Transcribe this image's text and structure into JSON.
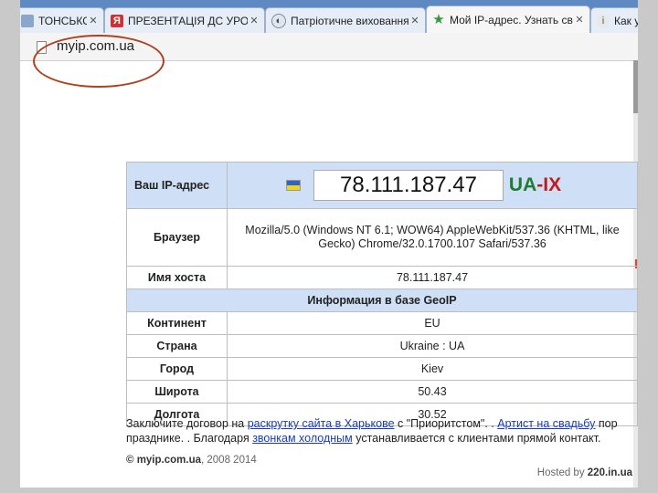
{
  "tabs": [
    {
      "title": "ТОНСЬКОЇ З",
      "favicon": "page-icon",
      "active": false
    },
    {
      "title": "ПРЕЗЕНТАЦІЯ ДС УРОКУ",
      "favicon": "yandex-icon",
      "active": false
    },
    {
      "title": "Патріотичне виховання в",
      "favicon": "web-icon",
      "active": false
    },
    {
      "title": "Мой IP-адрес. Узнать сво",
      "favicon": "star-icon",
      "active": true
    },
    {
      "title": "Как уз",
      "favicon": "info-icon",
      "active": false
    }
  ],
  "address_bar": {
    "url": "myip.com.ua"
  },
  "ip_table": {
    "ip_label": "Ваш IP-адрес",
    "ip_value": "78.111.187.47",
    "isp_ua": "UA",
    "isp_dash": "-",
    "isp_ix": "IX",
    "browser_label": "Браузер",
    "browser_value": "Mozilla/5.0 (Windows NT 6.1; WOW64) AppleWebKit/537.36 (KHTML, like Gecko) Chrome/32.0.1700.107 Safari/537.36",
    "host_label": "Имя хоста",
    "host_value": "78.111.187.47",
    "geoip_header": "Информация в базе GeoIP",
    "geo_rows": [
      {
        "label": "Континент",
        "value": "EU"
      },
      {
        "label": "Страна",
        "value": "Ukraine : UA"
      },
      {
        "label": "Город",
        "value": "Kiev"
      },
      {
        "label": "Широта",
        "value": "50.43"
      },
      {
        "label": "Долгота",
        "value": "30.52"
      }
    ]
  },
  "note": {
    "part1": "Заключите договор на ",
    "link1": "раскрутку сайта в Харькове",
    "part2": " с \"Приоритстом\". . ",
    "link2": "Артист на свадьбу",
    "part3": " пор",
    "part4": "празднике. . Благодаря ",
    "link3": "звонкам холодным",
    "part5": " устанавливается с клиентами прямой контакт."
  },
  "footer": {
    "copyright_symbol": "©",
    "copyright_site": "myip.com.ua",
    "copyright_years": ", 2008 2014",
    "hosted_label": "Hosted by ",
    "hosted_site": "220.in.ua"
  },
  "colors": {
    "tabbar": "#5f89c3",
    "table_header": "#cfe0f6",
    "link": "#1a3bb8",
    "annotation_oval": "#b0401e"
  }
}
